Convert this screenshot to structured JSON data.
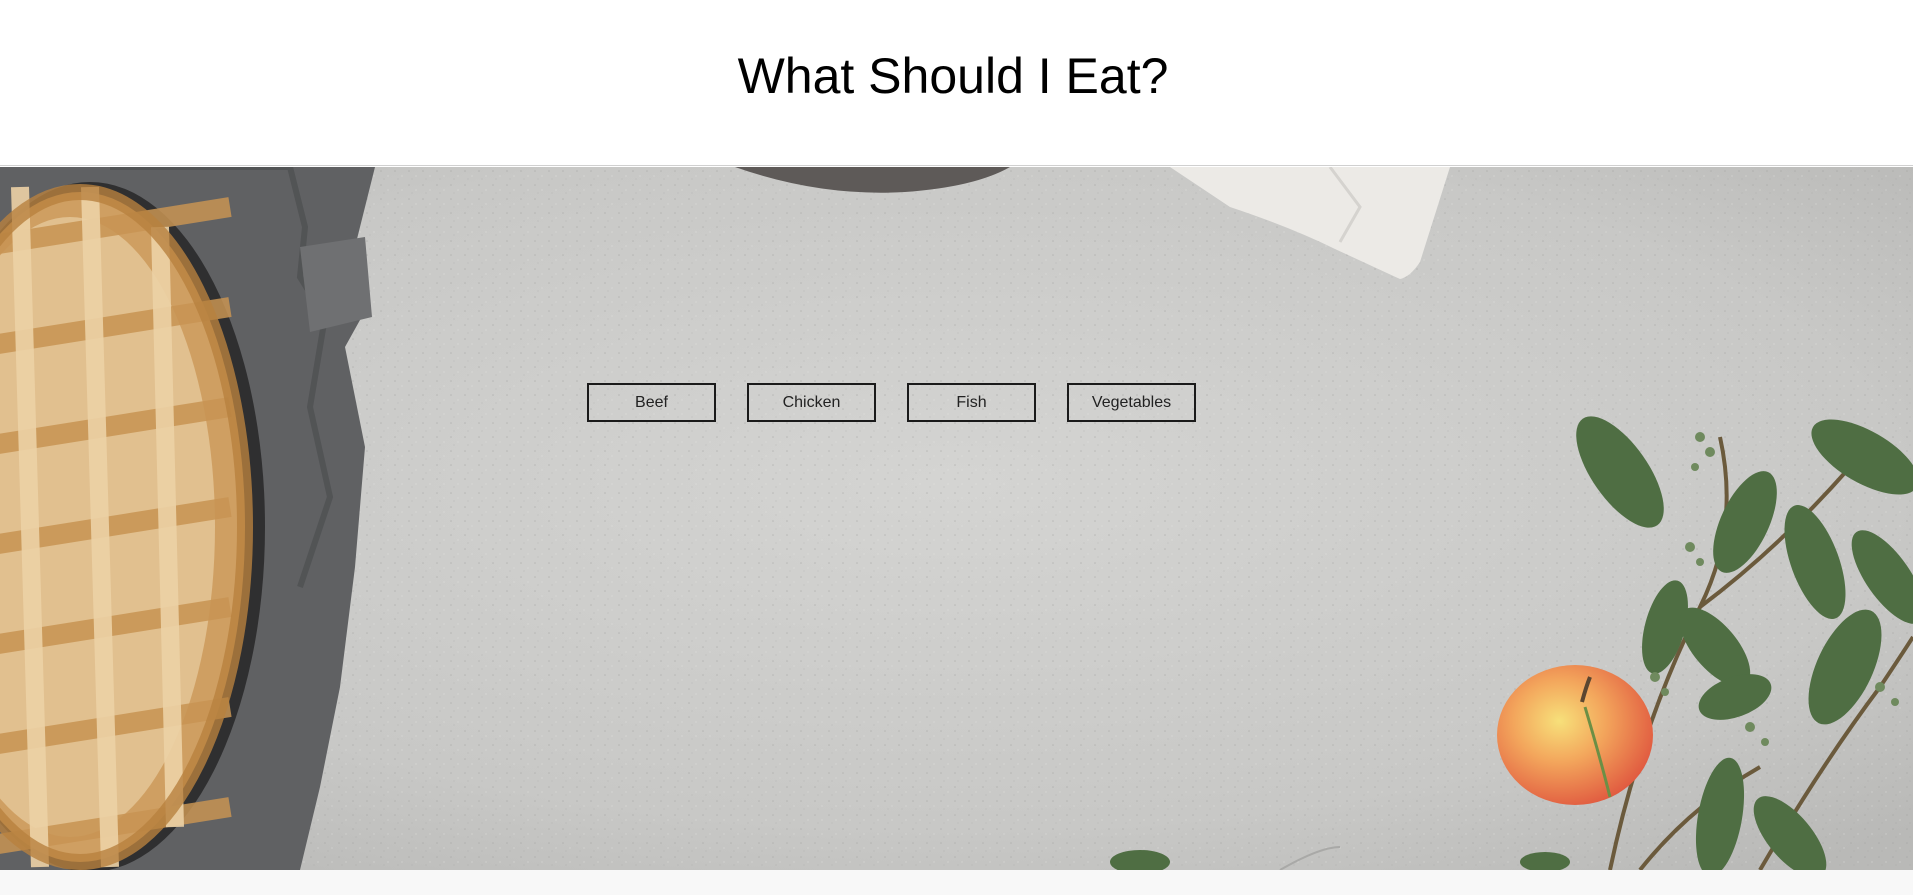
{
  "header": {
    "title": "What Should I Eat?"
  },
  "food_buttons": [
    {
      "label": "Beef"
    },
    {
      "label": "Chicken"
    },
    {
      "label": "Fish"
    },
    {
      "label": "Vegetables"
    }
  ],
  "hero": {
    "image_icon": "food-tabletop-photo",
    "colors": {
      "concrete": "#c9c9c7",
      "cloth": "#5f6062",
      "crust": "#d7b27c",
      "leaf": "#4f6e43",
      "apple": "#f0a35a"
    }
  }
}
